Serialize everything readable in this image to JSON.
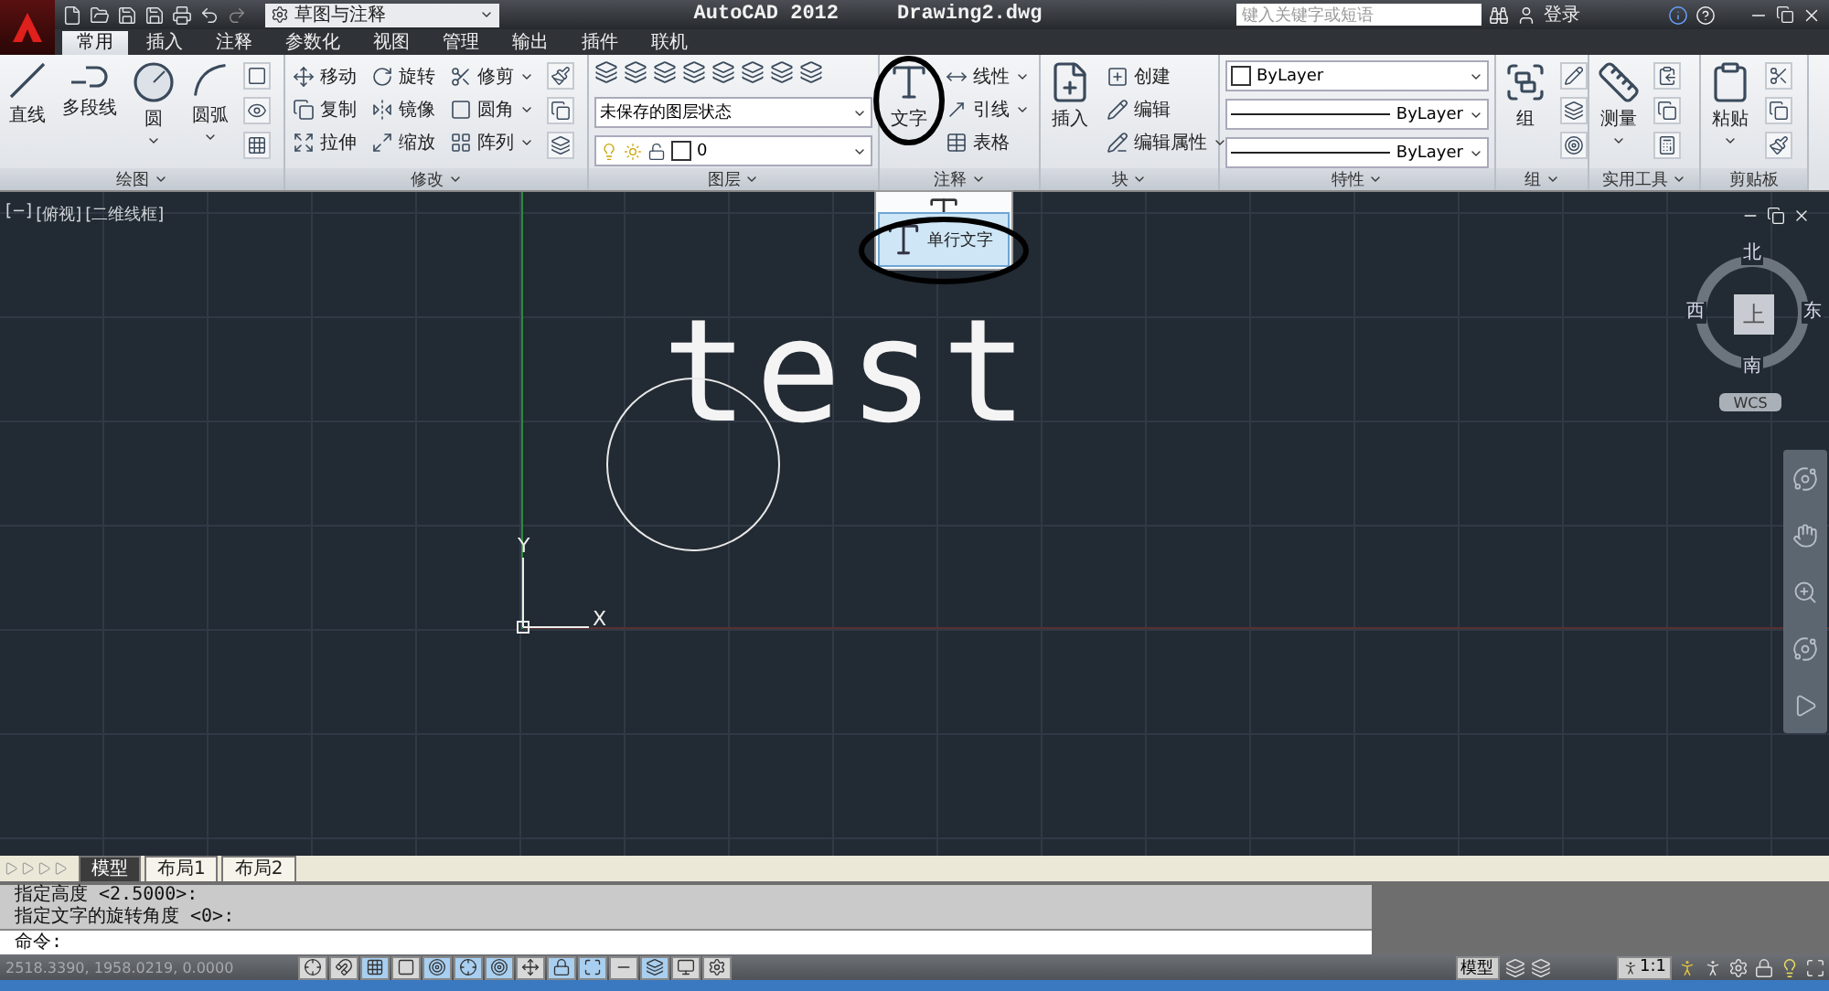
{
  "title_bar": {
    "workspace": "草图与注释",
    "app_title": "AutoCAD 2012",
    "file_name": "Drawing2.dwg",
    "search": {
      "placeholder": "键入关键字或短语"
    },
    "login": "登录"
  },
  "ribbon_tabs": [
    {
      "label": "常用",
      "selected": true
    },
    {
      "label": "插入",
      "selected": false
    },
    {
      "label": "注释",
      "selected": false
    },
    {
      "label": "参数化",
      "selected": false
    },
    {
      "label": "视图",
      "selected": false
    },
    {
      "label": "管理",
      "selected": false
    },
    {
      "label": "输出",
      "selected": false
    },
    {
      "label": "插件",
      "selected": false
    },
    {
      "label": "联机",
      "selected": false
    }
  ],
  "panels": [
    {
      "title": "绘图",
      "menu": true,
      "tools": [
        {
          "kind": "large",
          "label": "直线",
          "menu": false
        },
        {
          "kind": "large",
          "label": "多段线",
          "menu": false
        },
        {
          "kind": "large",
          "label": "圆",
          "menu": true
        },
        {
          "kind": "large",
          "label": "圆弧",
          "menu": true
        }
      ]
    },
    {
      "title": "修改",
      "menu": true,
      "tools": [
        {
          "kind": "small",
          "label": "移动",
          "menu": false
        },
        {
          "kind": "small",
          "label": "旋转",
          "menu": false
        },
        {
          "kind": "small",
          "label": "修剪",
          "menu": true
        },
        {
          "kind": "small",
          "label": "复制",
          "menu": false
        },
        {
          "kind": "small",
          "label": "镜像",
          "menu": false
        },
        {
          "kind": "small",
          "label": "圆角",
          "menu": true
        },
        {
          "kind": "small",
          "label": "拉伸",
          "menu": false
        },
        {
          "kind": "small",
          "label": "缩放",
          "menu": false
        },
        {
          "kind": "small",
          "label": "阵列",
          "menu": true
        }
      ]
    },
    {
      "title": "图层",
      "menu": true,
      "tools": [
        {
          "kind": "icon_row"
        },
        {
          "kind": "dropdown",
          "value": "未保存的图层状态"
        },
        {
          "kind": "layer",
          "value": "0"
        }
      ]
    },
    {
      "title": "注释",
      "menu": true,
      "tools": [
        {
          "kind": "large",
          "label": "文字",
          "menu": false
        },
        {
          "kind": "small",
          "label": "线性",
          "menu": true
        },
        {
          "kind": "small",
          "label": "引线",
          "menu": true
        },
        {
          "kind": "small",
          "label": "表格",
          "menu": false
        }
      ]
    },
    {
      "title": "块",
      "menu": true,
      "tools": [
        {
          "kind": "large",
          "label": "插入",
          "menu": false
        },
        {
          "kind": "small",
          "label": "创建",
          "menu": false
        },
        {
          "kind": "small",
          "label": "编辑",
          "menu": false
        },
        {
          "kind": "small",
          "label": "编辑属性",
          "menu": true
        }
      ]
    },
    {
      "title": "特性",
      "menu": true,
      "tools": [
        {
          "kind": "color",
          "value": "ByLayer"
        },
        {
          "kind": "linetype",
          "value": "ByLayer"
        },
        {
          "kind": "lineweight",
          "value": "ByLayer"
        }
      ]
    },
    {
      "title": "组",
      "menu": true,
      "tools": [
        {
          "kind": "large",
          "label": "组",
          "menu": false
        }
      ]
    },
    {
      "title": "实用工具",
      "menu": true,
      "tools": [
        {
          "kind": "large",
          "label": "测量",
          "menu": true
        }
      ]
    },
    {
      "title": "剪贴板",
      "menu": false,
      "tools": [
        {
          "kind": "large",
          "label": "粘贴",
          "menu": true
        }
      ]
    }
  ],
  "canvas": {
    "viewport_controls": [
      "[−]",
      "[俯视]",
      "[二维线框]"
    ],
    "text_flyout": {
      "items": [
        {
          "label": "单行文字",
          "selected": true
        }
      ]
    },
    "drawn_text": "test",
    "ucs": {
      "x_label": "X",
      "y_label": "Y"
    },
    "view_cube": {
      "north": "北",
      "south": "南",
      "east": "东",
      "west": "西",
      "face": "上",
      "coordinate_system": "WCS"
    }
  },
  "layout_tabs": [
    {
      "label": "模型",
      "selected": true
    },
    {
      "label": "布局1",
      "selected": false
    },
    {
      "label": "布局2",
      "selected": false
    }
  ],
  "command": {
    "history": [
      "指定高度 <2.5000>:",
      "指定文字的旋转角度 <0>:"
    ],
    "prompt": "命令:"
  },
  "status_bar": {
    "coordinates": "2518.3390, 1958.0219, 0.0000",
    "model_space": "模型",
    "annotation_scale": "1:1",
    "toggles": [
      {
        "on": false
      },
      {
        "on": false
      },
      {
        "on": true
      },
      {
        "on": false
      },
      {
        "on": true
      },
      {
        "on": true
      },
      {
        "on": true
      },
      {
        "on": false
      },
      {
        "on": true
      },
      {
        "on": true
      },
      {
        "on": false
      },
      {
        "on": true
      },
      {
        "on": false
      },
      {
        "on": false
      }
    ]
  }
}
